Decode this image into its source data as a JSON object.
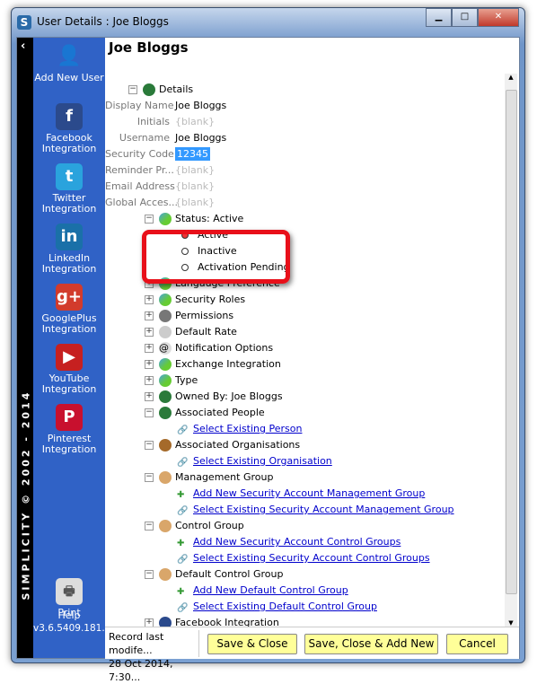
{
  "window": {
    "title": "User Details : Joe Bloggs",
    "app_icon": "S"
  },
  "strip": {
    "vertical_text": "SIMPLICITY © 2002 - 2014"
  },
  "sidebar": {
    "items": [
      {
        "label": "Add New User",
        "icon": "add-user-icon",
        "color": "#1a7a3a"
      },
      {
        "label": "Facebook Integration",
        "icon": "facebook-icon",
        "color": "#2b4a8c",
        "glyph": "f"
      },
      {
        "label": "Twitter Integration",
        "icon": "twitter-icon",
        "color": "#2aa3dd",
        "glyph": "t"
      },
      {
        "label": "LinkedIn Integration",
        "icon": "linkedin-icon",
        "color": "#1a70a8",
        "glyph": "in"
      },
      {
        "label": "GooglePlus Integration",
        "icon": "googleplus-icon",
        "color": "#d23b2c",
        "glyph": "g+"
      },
      {
        "label": "YouTube Integration",
        "icon": "youtube-icon",
        "color": "#c62020",
        "glyph": "▶"
      },
      {
        "label": "Pinterest Integration",
        "icon": "pinterest-icon",
        "color": "#c8102e",
        "glyph": "P"
      }
    ],
    "print": "Print",
    "help": "Help",
    "version": "v3.6.5409.181..."
  },
  "main": {
    "heading": "Joe Bloggs",
    "details": {
      "label": "Details",
      "fields": [
        {
          "label": "Display Name",
          "value": "Joe Bloggs"
        },
        {
          "label": "Initials",
          "value": "{blank}",
          "blank": true
        },
        {
          "label": "Username",
          "value": "Joe Bloggs"
        },
        {
          "label": "Security Code",
          "value": "12345",
          "selected": true
        },
        {
          "label": "Reminder Pr...",
          "value": "{blank}",
          "blank": true
        },
        {
          "label": "Email Address",
          "value": "{blank}",
          "blank": true
        },
        {
          "label": "Global Acces...",
          "value": "{blank}",
          "blank": true
        }
      ]
    },
    "tree": [
      {
        "level": 0,
        "exp": "−",
        "icon": "globe-icon",
        "label": "Status:  Active"
      },
      {
        "level": 1,
        "radio": true,
        "on": true,
        "label": "Active"
      },
      {
        "level": 1,
        "radio": true,
        "label": "Inactive"
      },
      {
        "level": 1,
        "radio": true,
        "label": "Activation Pending"
      },
      {
        "level": 0,
        "exp": "+",
        "icon": "globe-icon",
        "label": "Langauge Preference"
      },
      {
        "level": 0,
        "exp": "+",
        "icon": "globe-icon",
        "label": "Security Roles"
      },
      {
        "level": 0,
        "exp": "+",
        "icon": "permissions-icon",
        "label": "Permissions"
      },
      {
        "level": 0,
        "exp": "+",
        "icon": "rate-icon",
        "label": "Default Rate"
      },
      {
        "level": 0,
        "exp": "+",
        "icon": "at-icon",
        "label": "Notification Options"
      },
      {
        "level": 0,
        "exp": "+",
        "icon": "globe-icon",
        "label": "Exchange Integration"
      },
      {
        "level": 0,
        "exp": "+",
        "icon": "globe-icon",
        "label": "Type"
      },
      {
        "level": 0,
        "exp": "+",
        "icon": "person-icon",
        "label": "Owned By:  Joe Bloggs"
      },
      {
        "level": 0,
        "exp": "−",
        "icon": "person-icon",
        "label": "Associated People"
      },
      {
        "level": 1,
        "icon": "link-icon",
        "label": "Select Existing Person",
        "link": true
      },
      {
        "level": 0,
        "exp": "−",
        "icon": "people-icon",
        "label": "Associated Organisations"
      },
      {
        "level": 1,
        "icon": "link-icon",
        "label": "Select Existing Organisation",
        "link": true
      },
      {
        "level": 0,
        "exp": "−",
        "icon": "handshake-icon",
        "label": "Management Group"
      },
      {
        "level": 1,
        "icon": "plus-icon",
        "label": "Add New Security Account Management Group",
        "link": true
      },
      {
        "level": 1,
        "icon": "link-icon",
        "label": "Select Existing Security Account Management Group",
        "link": true
      },
      {
        "level": 0,
        "exp": "−",
        "icon": "handshake-icon",
        "label": "Control Group"
      },
      {
        "level": 1,
        "icon": "plus-icon",
        "label": "Add New Security Account Control Groups",
        "link": true
      },
      {
        "level": 1,
        "icon": "link-icon",
        "label": "Select Existing Security Account Control Groups",
        "link": true
      },
      {
        "level": 0,
        "exp": "−",
        "icon": "handshake-icon",
        "label": "Default Control Group"
      },
      {
        "level": 1,
        "icon": "plus-icon",
        "label": "Add New Default Control Group",
        "link": true
      },
      {
        "level": 1,
        "icon": "link-icon",
        "label": "Select Existing Default Control Group",
        "link": true
      },
      {
        "level": 0,
        "exp": "+",
        "icon": "facebook-icon",
        "label": "Facebook Integration"
      }
    ]
  },
  "footer": {
    "record_line1": "Record last modife...",
    "record_line2": "28 Oct 2014, 7:30...",
    "save_close": "Save & Close",
    "save_close_add": "Save, Close & Add New",
    "cancel": "Cancel"
  },
  "colors": {
    "sidebar": "#3062c6",
    "highlight": "#e8101a",
    "button": "#ffff99",
    "link": "#0000cc"
  }
}
